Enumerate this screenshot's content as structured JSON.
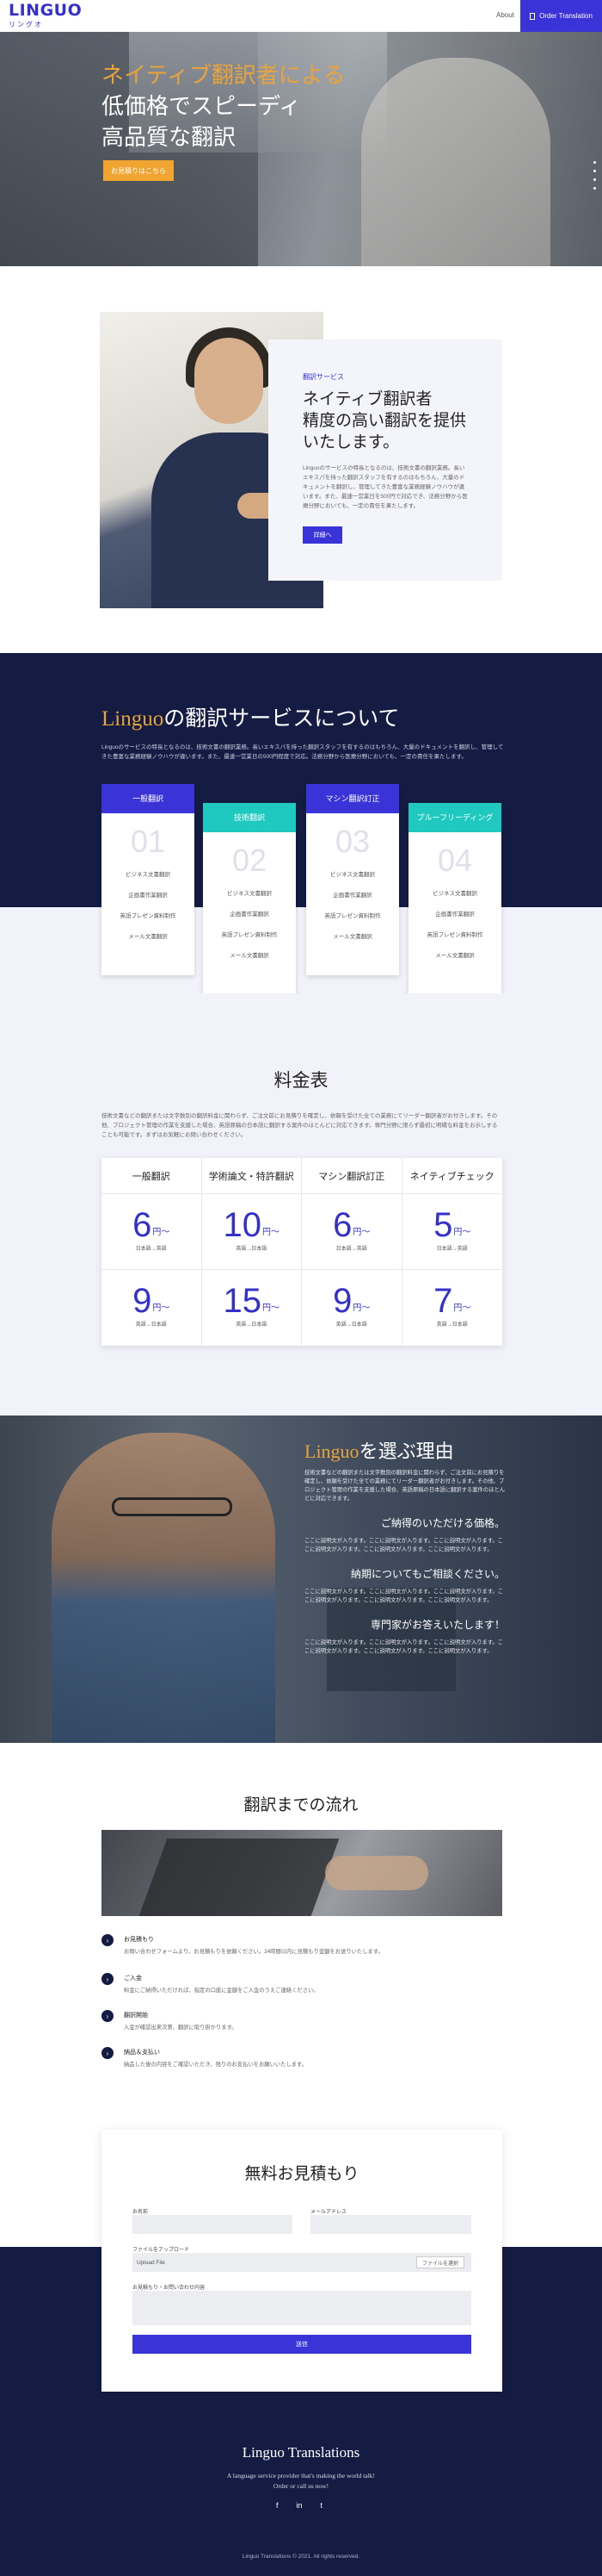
{
  "header": {
    "logo": "LINGUO",
    "logo_sub": "リングオ",
    "nav_about": "About",
    "nav_order": "Order Translation",
    "colors": {
      "brand": "#3a34d8",
      "accent": "#e8a43a",
      "navy": "#141c44"
    }
  },
  "hero": {
    "line1": "ネイティブ翻訳者による",
    "line2": "低価格でスピーディ",
    "line3": "高品質な翻訳",
    "button": "お見積りはこちら"
  },
  "intro": {
    "label": "翻訳サービス",
    "title1": "ネイティブ翻訳者",
    "title2": "精度の高い翻訳を提供",
    "title3": "いたします。",
    "body": "Linguoのサービスの特長となるのは、技術文書の翻訳業務。長いエキスパを持った翻訳スタッフを有するのはもちろん、大量のドキュメントを翻訳し、管理してきた豊富な業務経験ノウハウが違います。また、最速一営業日を500円で対応でき、法務分野から医療分野においても、一定の責任を果たします。",
    "button": "詳細へ"
  },
  "services": {
    "title_accent": "Linguo",
    "title_rest": "の翻訳サービスについて",
    "desc": "Linguoのサービスの特長となるのは、技術文書の翻訳業務。長いエキスパを持った翻訳スタッフを有するのはもちろん、大量のドキュメントを翻訳し、管理してきた豊富な業務経験ノウハウが違います。また、最速一営業日の500円程度で対応。法務分野から医療分野においても、一定の責任を果たします。",
    "cards": [
      {
        "name": "一般翻訳",
        "num": "01",
        "color": "#3a34d8",
        "items": [
          "ビジネス文書翻訳",
          "企画書作業翻訳",
          "英語プレゼン資料制作",
          "メール文書翻訳"
        ]
      },
      {
        "name": "技術翻訳",
        "num": "02",
        "color": "#1fc9c0",
        "items": [
          "ビジネス文書翻訳",
          "企画書作業翻訳",
          "英語プレゼン資料制作",
          "メール文書翻訳"
        ]
      },
      {
        "name": "マシン翻訳訂正",
        "num": "03",
        "color": "#3a34d8",
        "items": [
          "ビジネス文書翻訳",
          "企画書作業翻訳",
          "英語プレゼン資料制作",
          "メール文書翻訳"
        ]
      },
      {
        "name": "プルーフリーディング",
        "num": "04",
        "color": "#1fc9c0",
        "items": [
          "ビジネス文書翻訳",
          "企画書作業翻訳",
          "英語プレゼン資料制作",
          "メール文書翻訳"
        ]
      }
    ]
  },
  "pricing": {
    "title": "料金表",
    "desc": "技術文書などの翻訳または文字数別の翻訳料金に関わらず、ご注文前にお見積りを確定し、依頼を受けた全ての業務にてリーダー翻訳者がお付きします。その他、プロジェクト管理の作業を支援した場合、英語原稿の日本語に翻訳する案件のほとんどに対応できます。専門分野に限らず最初に明確な料金をお示しすることも可能です。まずはお気軽にお問い合わせください。",
    "columns": [
      "一般翻訳",
      "学術論文・特許翻訳",
      "マシン翻訳訂正",
      "ネイティブチェック"
    ],
    "rows": [
      [
        {
          "num": "6",
          "unit": "円〜",
          "note": "日本語→英語"
        },
        {
          "num": "10",
          "unit": "円〜",
          "note": "英語→日本語"
        },
        {
          "num": "6",
          "unit": "円〜",
          "note": "日本語→英語"
        },
        {
          "num": "5",
          "unit": "円〜",
          "note": "日本語→英語"
        }
      ],
      [
        {
          "num": "9",
          "unit": "円〜",
          "note": "英語→日本語"
        },
        {
          "num": "15",
          "unit": "円〜",
          "note": "英語→日本語"
        },
        {
          "num": "9",
          "unit": "円〜",
          "note": "英語→日本語"
        },
        {
          "num": "7",
          "unit": "円〜",
          "note": "英語→日本語"
        }
      ]
    ]
  },
  "reasons": {
    "title_accent": "Linguo",
    "title_rest": "を選ぶ理由",
    "p1": "技術文書などの翻訳または文字数別の翻訳料金に関わらず、ご注文前にお見積りを確定し、依頼を受けた全ての業務にてリーダー翻訳者がお付きします。その他、プロジェクト管理の作業を支援した場合、英語原稿の日本語に翻訳する案件のほとんどに対応できます。",
    "h2": "ご納得のいただける価格。",
    "p2": "ここに説明文が入ります。ここに説明文が入ります。ここに説明文が入ります。ここに説明文が入ります。ここに説明文が入ります。ここに説明文が入ります。",
    "h3": "納期についてもご相談ください。",
    "p3": "ここに説明文が入ります。ここに説明文が入ります。ここに説明文が入ります。ここに説明文が入ります。ここに説明文が入ります。ここに説明文が入ります。",
    "h4": "専門家がお答えいたします！",
    "p4": "ここに説明文が入ります。ここに説明文が入ります。ここに説明文が入ります。ここに説明文が入ります。ここに説明文が入ります。ここに説明文が入ります。"
  },
  "flow": {
    "title": "翻訳までの流れ",
    "steps": [
      {
        "title": "お見積もり",
        "desc": "お問い合わせフォームより、お見積もりを依頼ください。24時間以内に見積もり金額をお送りいたします。"
      },
      {
        "title": "ご入金",
        "desc": "料金にご納得いただければ、指定の口座に金額をご入金のうえご連絡ください。"
      },
      {
        "title": "翻訳開始",
        "desc": "入金が確認出来次第、翻訳に取り掛かります。"
      },
      {
        "title": "納品＆支払い",
        "desc": "納品した後の内容をご確認いただき、残りのお支払いをお願いいたします。"
      }
    ]
  },
  "form": {
    "title": "無料お見積もり",
    "name_label": "お名前",
    "email_label": "メールアドレス",
    "file_label": "ファイルをアップロード",
    "file_placeholder": "Upload File",
    "file_button": "ファイルを選択",
    "message_label": "お見積もり・お問い合わせ内容",
    "submit": "送信"
  },
  "footer": {
    "title": "Linguo Translations",
    "tag1": "A language service provider that's making the world talk!",
    "tag2": "Order or call us now!",
    "social": [
      "f",
      "in",
      "t"
    ],
    "copyright": "Linguo Translations © 2021. All rights reserved."
  }
}
